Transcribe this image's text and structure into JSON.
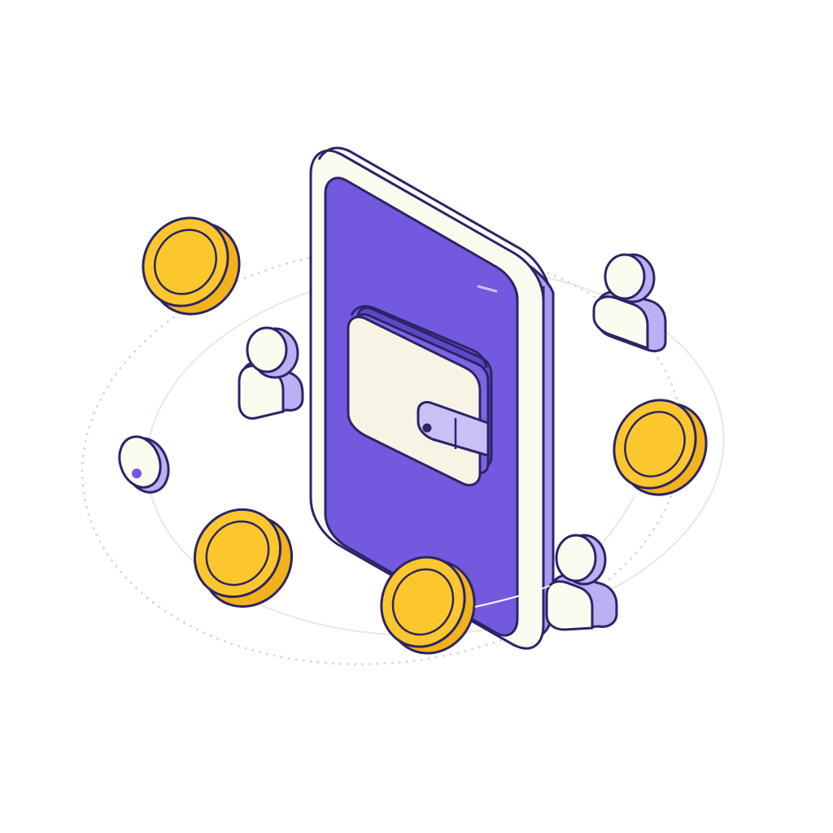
{
  "illustration": {
    "subject": "mobile-wallet",
    "icons": [
      "smartphone-icon",
      "wallet-icon",
      "coin-icon",
      "user-icon"
    ]
  },
  "colors": {
    "outline": "#2b2467",
    "phone_screen": "#7359dd",
    "phone_frame": "#fcfbef",
    "phone_side": "#a99af0",
    "wallet_body": "#f7f4e6",
    "wallet_strap": "#c9c0f5",
    "coin_face": "#fcc72d",
    "coin_edge": "#f2b21b",
    "user_light": "#fcfbef",
    "user_lavender": "#bcb0f4",
    "orbit_line": "#ebe7df",
    "orbit_dots": "#d9d5e6",
    "background": "#ffffff"
  }
}
